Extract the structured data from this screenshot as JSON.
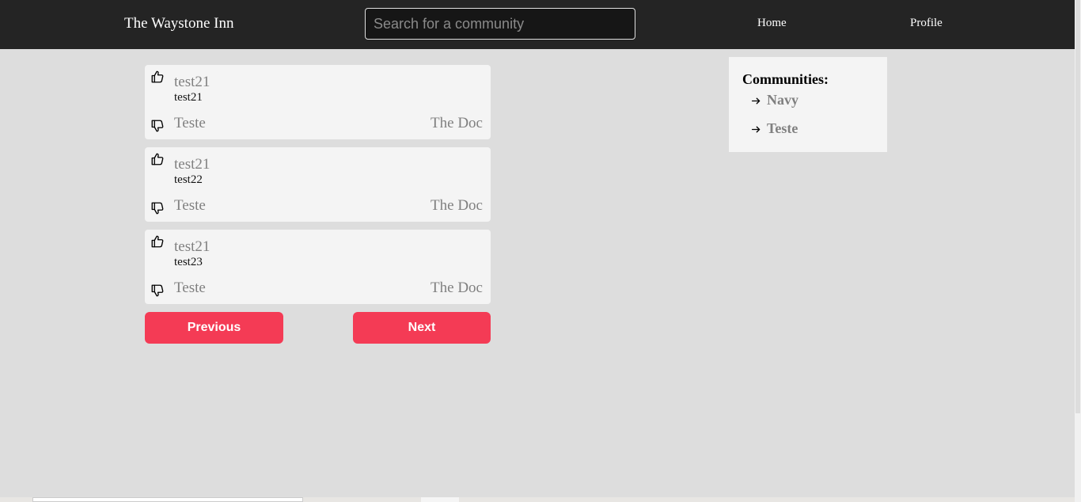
{
  "navbar": {
    "brand": "The Waystone Inn",
    "search_placeholder": "Search for a community",
    "links": [
      {
        "label": "Home"
      },
      {
        "label": "Profile"
      }
    ]
  },
  "posts": [
    {
      "title": "test21",
      "body": "test21",
      "community": "Teste",
      "author": "The Doc"
    },
    {
      "title": "test21",
      "body": "test22",
      "community": "Teste",
      "author": "The Doc"
    },
    {
      "title": "test21",
      "body": "test23",
      "community": "Teste",
      "author": "The Doc"
    }
  ],
  "pagination": {
    "previous_label": "Previous",
    "next_label": "Next"
  },
  "sidebar": {
    "title": "Communities:",
    "communities": [
      {
        "name": "Navy"
      },
      {
        "name": "Teste"
      }
    ]
  },
  "icons": {
    "upvote": "thumbs-up-icon",
    "downvote": "thumbs-down-icon",
    "community_link": "arrow-right-icon"
  },
  "colors": {
    "navbar_bg": "#242424",
    "page_bg": "#dddddd",
    "card_bg": "#f4f4f4",
    "accent": "#f43b55",
    "muted_text": "#808080"
  }
}
